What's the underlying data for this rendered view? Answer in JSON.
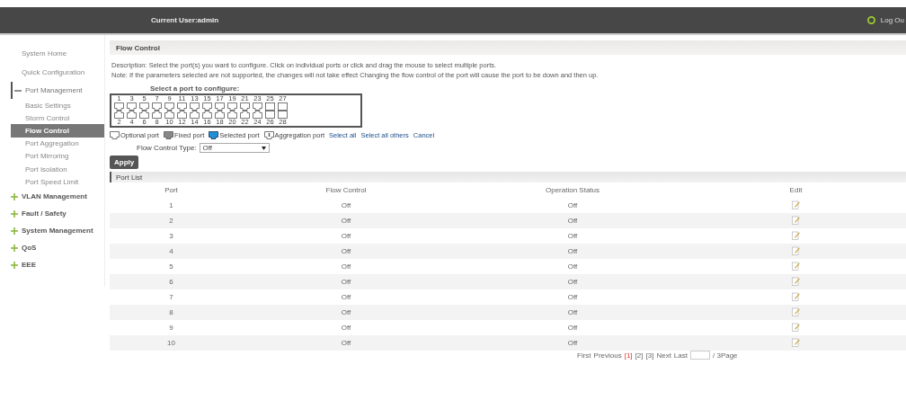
{
  "header": {
    "current_user": "Current User:admin",
    "logout": "Log Ou"
  },
  "sidebar": [
    {
      "label": "System Home",
      "kind": "top"
    },
    {
      "label": "Quick Configuration",
      "kind": "top"
    },
    {
      "label": "Port Management",
      "kind": "group",
      "expanded": true,
      "children": [
        {
          "label": "Basic Settings",
          "selected": false
        },
        {
          "label": "Storm Control",
          "selected": false
        },
        {
          "label": "Flow Control",
          "selected": true
        },
        {
          "label": "Port Aggregation",
          "selected": false
        },
        {
          "label": "Port Mirroring",
          "selected": false
        },
        {
          "label": "Port Isolation",
          "selected": false
        },
        {
          "label": "Port Speed Limit",
          "selected": false
        }
      ]
    },
    {
      "label": "VLAN Management",
      "kind": "group",
      "expanded": false
    },
    {
      "label": "Fault / Safety",
      "kind": "group",
      "expanded": false
    },
    {
      "label": "System Management",
      "kind": "group",
      "expanded": false
    },
    {
      "label": "QoS",
      "kind": "group",
      "expanded": false
    },
    {
      "label": "EEE",
      "kind": "group",
      "expanded": false
    }
  ],
  "page_title": "Flow Control",
  "description": "Description: Select the port(s) you want to configure. Click on individual ports or click and drag the mouse to select multiple ports.",
  "note": "Note: If the parameters selected are not supported, the changes will not take effect Changing the flow control of the port will cause the port to be down and then up.",
  "port_select_label": "Select a port to configure:",
  "ports": [
    {
      "label": "1",
      "kind": "rj45",
      "selected": false
    },
    {
      "label": "2",
      "kind": "rj45",
      "selected": false
    },
    {
      "label": "3",
      "kind": "rj45",
      "selected": false
    },
    {
      "label": "4",
      "kind": "rj45",
      "selected": false
    },
    {
      "label": "5",
      "kind": "rj45",
      "selected": false
    },
    {
      "label": "6",
      "kind": "rj45",
      "selected": false
    },
    {
      "label": "7",
      "kind": "rj45",
      "selected": false
    },
    {
      "label": "8",
      "kind": "rj45",
      "selected": false
    },
    {
      "label": "9",
      "kind": "rj45",
      "selected": false
    },
    {
      "label": "10",
      "kind": "rj45",
      "selected": false
    },
    {
      "label": "11",
      "kind": "rj45",
      "selected": false
    },
    {
      "label": "12",
      "kind": "rj45",
      "selected": false
    },
    {
      "label": "13",
      "kind": "rj45",
      "selected": false
    },
    {
      "label": "14",
      "kind": "rj45",
      "selected": false
    },
    {
      "label": "15",
      "kind": "rj45",
      "selected": false
    },
    {
      "label": "16",
      "kind": "rj45",
      "selected": false
    },
    {
      "label": "17",
      "kind": "rj45",
      "selected": false
    },
    {
      "label": "18",
      "kind": "rj45",
      "selected": false
    },
    {
      "label": "19",
      "kind": "rj45",
      "selected": false
    },
    {
      "label": "20",
      "kind": "rj45",
      "selected": false
    },
    {
      "label": "21",
      "kind": "rj45",
      "selected": false
    },
    {
      "label": "22",
      "kind": "rj45",
      "selected": false
    },
    {
      "label": "23",
      "kind": "rj45",
      "selected": false
    },
    {
      "label": "24",
      "kind": "rj45",
      "selected": false
    },
    {
      "label": "25",
      "kind": "sfp",
      "selected": false
    },
    {
      "label": "26",
      "kind": "sfp",
      "selected": false
    },
    {
      "label": "27",
      "kind": "sfp",
      "selected": false
    },
    {
      "label": "28",
      "kind": "sfp",
      "selected": false
    }
  ],
  "legend": [
    {
      "kind": "optional",
      "label": "Optional port"
    },
    {
      "kind": "fixed",
      "label": "Fixed port"
    },
    {
      "kind": "selected",
      "label": "Selected port"
    },
    {
      "kind": "aggregation",
      "label": "Aggregation port"
    }
  ],
  "select_links": [
    "Select all",
    "Select all others",
    "Cancel"
  ],
  "flow_control_type": {
    "label": "Flow Control Type:",
    "value": "Off"
  },
  "apply_button": "Apply",
  "port_list": {
    "title": "Port List",
    "columns": [
      "Port",
      "Flow Control",
      "Operation Status",
      "Edit"
    ],
    "rows": [
      {
        "port": "1",
        "flow_control": "Off",
        "operation_status": "Off"
      },
      {
        "port": "2",
        "flow_control": "Off",
        "operation_status": "Off"
      },
      {
        "port": "3",
        "flow_control": "Off",
        "operation_status": "Off"
      },
      {
        "port": "4",
        "flow_control": "Off",
        "operation_status": "Off"
      },
      {
        "port": "5",
        "flow_control": "Off",
        "operation_status": "Off"
      },
      {
        "port": "6",
        "flow_control": "Off",
        "operation_status": "Off"
      },
      {
        "port": "7",
        "flow_control": "Off",
        "operation_status": "Off"
      },
      {
        "port": "8",
        "flow_control": "Off",
        "operation_status": "Off"
      },
      {
        "port": "9",
        "flow_control": "Off",
        "operation_status": "Off"
      },
      {
        "port": "10",
        "flow_control": "Off",
        "operation_status": "Off"
      }
    ]
  },
  "pagination": {
    "first": "First",
    "previous": "Previous",
    "pages": [
      {
        "label": "[1]",
        "selected": true
      },
      {
        "label": "[2]",
        "selected": false
      },
      {
        "label": "[3]",
        "selected": false
      }
    ],
    "next": "Next",
    "last": "Last",
    "suffix": "/ 3Page"
  }
}
